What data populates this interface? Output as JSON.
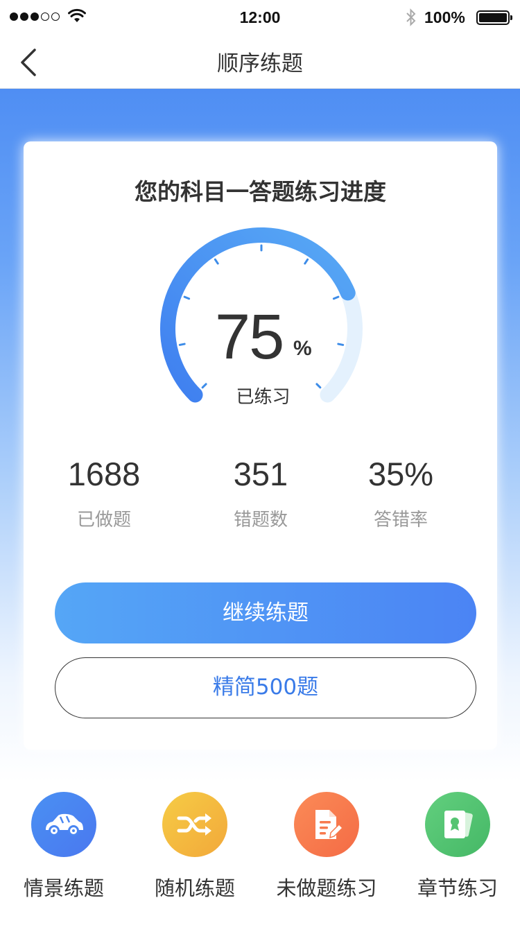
{
  "status_bar": {
    "time": "12:00",
    "battery_percent": "100%"
  },
  "nav": {
    "title": "顺序练题"
  },
  "progress_card": {
    "title": "您的科目一答题练习进度",
    "percent": "75",
    "percent_value": 0.75,
    "unit": "%",
    "label": "已练习",
    "stats": [
      {
        "value": "1688",
        "label": "已做题"
      },
      {
        "value": "351",
        "label": "错题数"
      },
      {
        "value": "35%",
        "label": "答错率"
      }
    ],
    "primary_button": "继续练题",
    "secondary_button": "精简500题"
  },
  "shortcuts": [
    {
      "label": "情景练题",
      "icon": "car-icon",
      "color": "#4a86f2"
    },
    {
      "label": "随机练题",
      "icon": "shuffle-icon",
      "color": "#f4b73e"
    },
    {
      "label": "未做题练习",
      "icon": "document-edit-icon",
      "color": "#f77a4e"
    },
    {
      "label": "章节练习",
      "icon": "certificate-icon",
      "color": "#55c472"
    }
  ],
  "colors": {
    "accent": "#4b84f4",
    "gauge_track": "#e4f1fd",
    "link": "#3a7be8"
  }
}
